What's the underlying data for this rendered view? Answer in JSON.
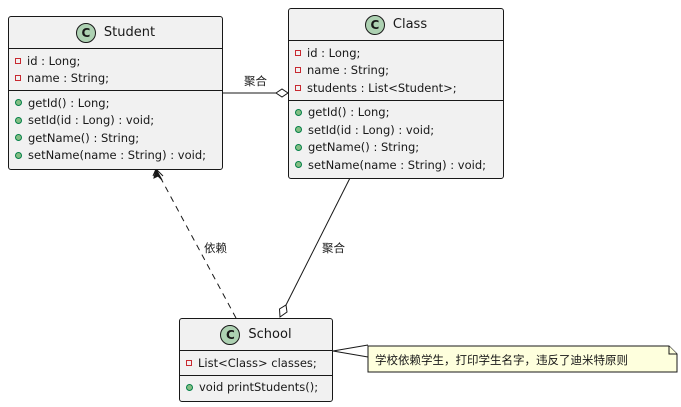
{
  "classes": [
    {
      "name": "Student",
      "fields": [
        "id : Long;",
        "name : String;"
      ],
      "methods": [
        "getId() : Long;",
        "setId(id : Long) : void;",
        "getName() : String;",
        "setName(name : String) : void;"
      ]
    },
    {
      "name": "Class",
      "fields": [
        "id : Long;",
        "name : String;",
        "students : List<Student>;"
      ],
      "methods": [
        "getId() : Long;",
        "setId(id : Long) : void;",
        "getName() : String;",
        "setName(name : String) : void;"
      ]
    },
    {
      "name": "School",
      "fields": [
        "List<Class> classes;"
      ],
      "methods": [
        "void printStudents();"
      ]
    }
  ],
  "badge_letter": "C",
  "relations": [
    {
      "from": "Class",
      "to": "Student",
      "kind": "aggregation",
      "label": "聚合"
    },
    {
      "from": "School",
      "to": "Class",
      "kind": "aggregation",
      "label": "聚合"
    },
    {
      "from": "School",
      "to": "Student",
      "kind": "dependency",
      "label": "依赖"
    }
  ],
  "note": "学校依赖学生，打印学生名字，违反了迪米特原则",
  "colors": {
    "class_fill": "#f1f1f1",
    "badge": "#add1b2",
    "note_fill": "#feffdd",
    "private": "#c82930",
    "public": "#84be84"
  }
}
